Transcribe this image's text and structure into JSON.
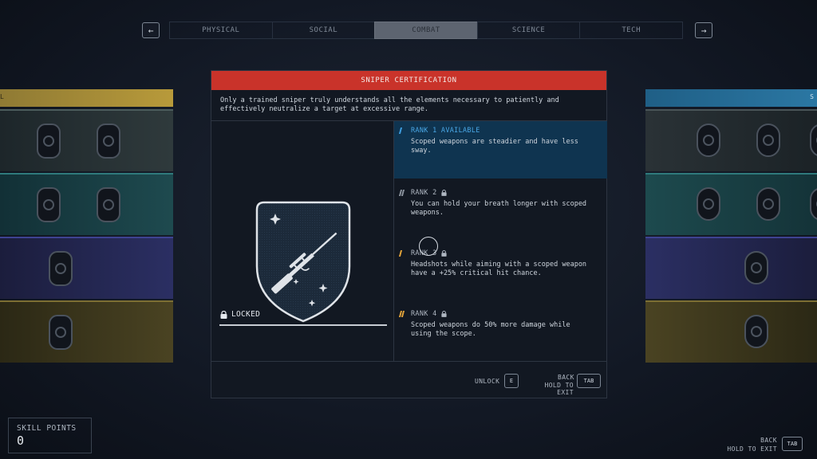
{
  "nav": {
    "prev_icon": "arrow-left-icon",
    "next_icon": "arrow-right-icon",
    "prev_glyph": "←",
    "next_glyph": "→",
    "tabs": [
      {
        "label": "PHYSICAL",
        "active": false
      },
      {
        "label": "SOCIAL",
        "active": false
      },
      {
        "label": "COMBAT",
        "active": true
      },
      {
        "label": "SCIENCE",
        "active": false
      },
      {
        "label": "TECH",
        "active": false
      }
    ]
  },
  "side_headers": {
    "left_fragment": "L",
    "right_fragment": "S"
  },
  "modal": {
    "title": "SNIPER CERTIFICATION",
    "description": "Only a trained sniper truly understands all the elements necessary to patiently and effectively neutralize a target at excessive range.",
    "emblem": "sniper-rifle-patch",
    "status": "LOCKED",
    "ranks": [
      {
        "title": "RANK 1 AVAILABLE",
        "text": "Scoped weapons are steadier and have less sway.",
        "locked": false,
        "active": true
      },
      {
        "title": "RANK 2",
        "text": "You can hold your breath longer with scoped weapons.",
        "locked": true,
        "active": false
      },
      {
        "title": "RANK 3",
        "text": "Headshots while aiming with a scoped weapon have a +25% critical hit chance.",
        "locked": true,
        "active": false
      },
      {
        "title": "RANK 4",
        "text": "Scoped weapons do 50% more damage while using the scope.",
        "locked": true,
        "active": false
      }
    ],
    "footer": {
      "unlock_label": "UNLOCK",
      "unlock_key": "E",
      "back_label": "BACK",
      "hold_label": "HOLD TO EXIT",
      "back_key": "TAB"
    }
  },
  "skill_points": {
    "label": "SKILL POINTS",
    "value": "0"
  },
  "bottom_back": {
    "label": "BACK",
    "hold_label": "HOLD TO EXIT",
    "key": "TAB"
  },
  "colors": {
    "title_bar": "#c9332a",
    "active_rank_bg": "#0f3450",
    "active_rank_text": "#49a7e6",
    "physical_row": "#b89a3a",
    "social_row": "#2f8a8c",
    "combat_row": "#3a3f8a",
    "science_row": "#2e6b8c"
  }
}
